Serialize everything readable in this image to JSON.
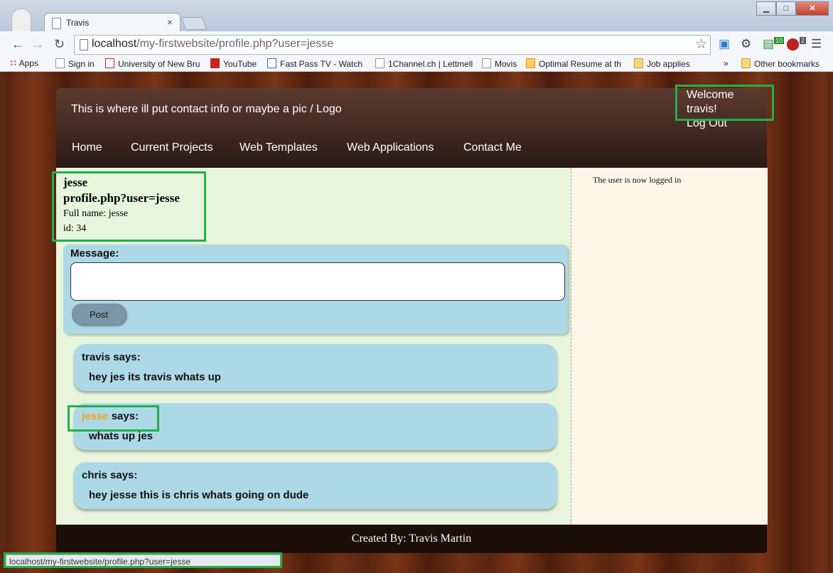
{
  "browser": {
    "tab_title": "Travis",
    "tab_close": "×",
    "url_host": "localhost",
    "url_path": "/my-firstwebsite/profile.php?user=jesse",
    "window_buttons": {
      "minimize": "▁",
      "maximize": "□",
      "close": "✕"
    },
    "ext_badges": {
      "badge1": "10",
      "badge2": "2"
    }
  },
  "bookmarks": {
    "items": [
      "Apps",
      "Sign in",
      "University of New Bru",
      "YouTube",
      "Fast Pass TV - Watch",
      "1Channel.ch | Lettmell",
      "Movis",
      "Optimal Resume at th",
      "Job applies"
    ],
    "overflow": "»",
    "other": "Other bookmarks"
  },
  "site": {
    "contact": "This is where ill put contact info or maybe a pic / Logo",
    "welcome": "Welcome travis!",
    "logout": "Log Out",
    "nav": [
      "Home",
      "Current Projects",
      "Web Templates",
      "Web Applications",
      "Contact Me"
    ],
    "sidebar_text": "The user is now logged in",
    "footer": "Created By: Travis Martin"
  },
  "profile": {
    "username": "jesse",
    "link": "profile.php?user=jesse",
    "fullname": "Full name: jesse",
    "id": "id: 34"
  },
  "composer": {
    "label": "Message:",
    "button": "Post"
  },
  "posts": [
    {
      "name": "travis",
      "says": " says:",
      "text": "hey jes its travis whats up"
    },
    {
      "name": "jesse",
      "says": " says:",
      "text": "whats up jes"
    },
    {
      "name": "chris",
      "says": " says:",
      "text": "hey jesse this is chris whats going on dude"
    }
  ],
  "statusbar": "localhost/my-firstwebsite/profile.php?user=jesse",
  "colors": {
    "highlight": "#22b04b",
    "self_name": "#f7a21b",
    "bubble": "#add8e6"
  }
}
